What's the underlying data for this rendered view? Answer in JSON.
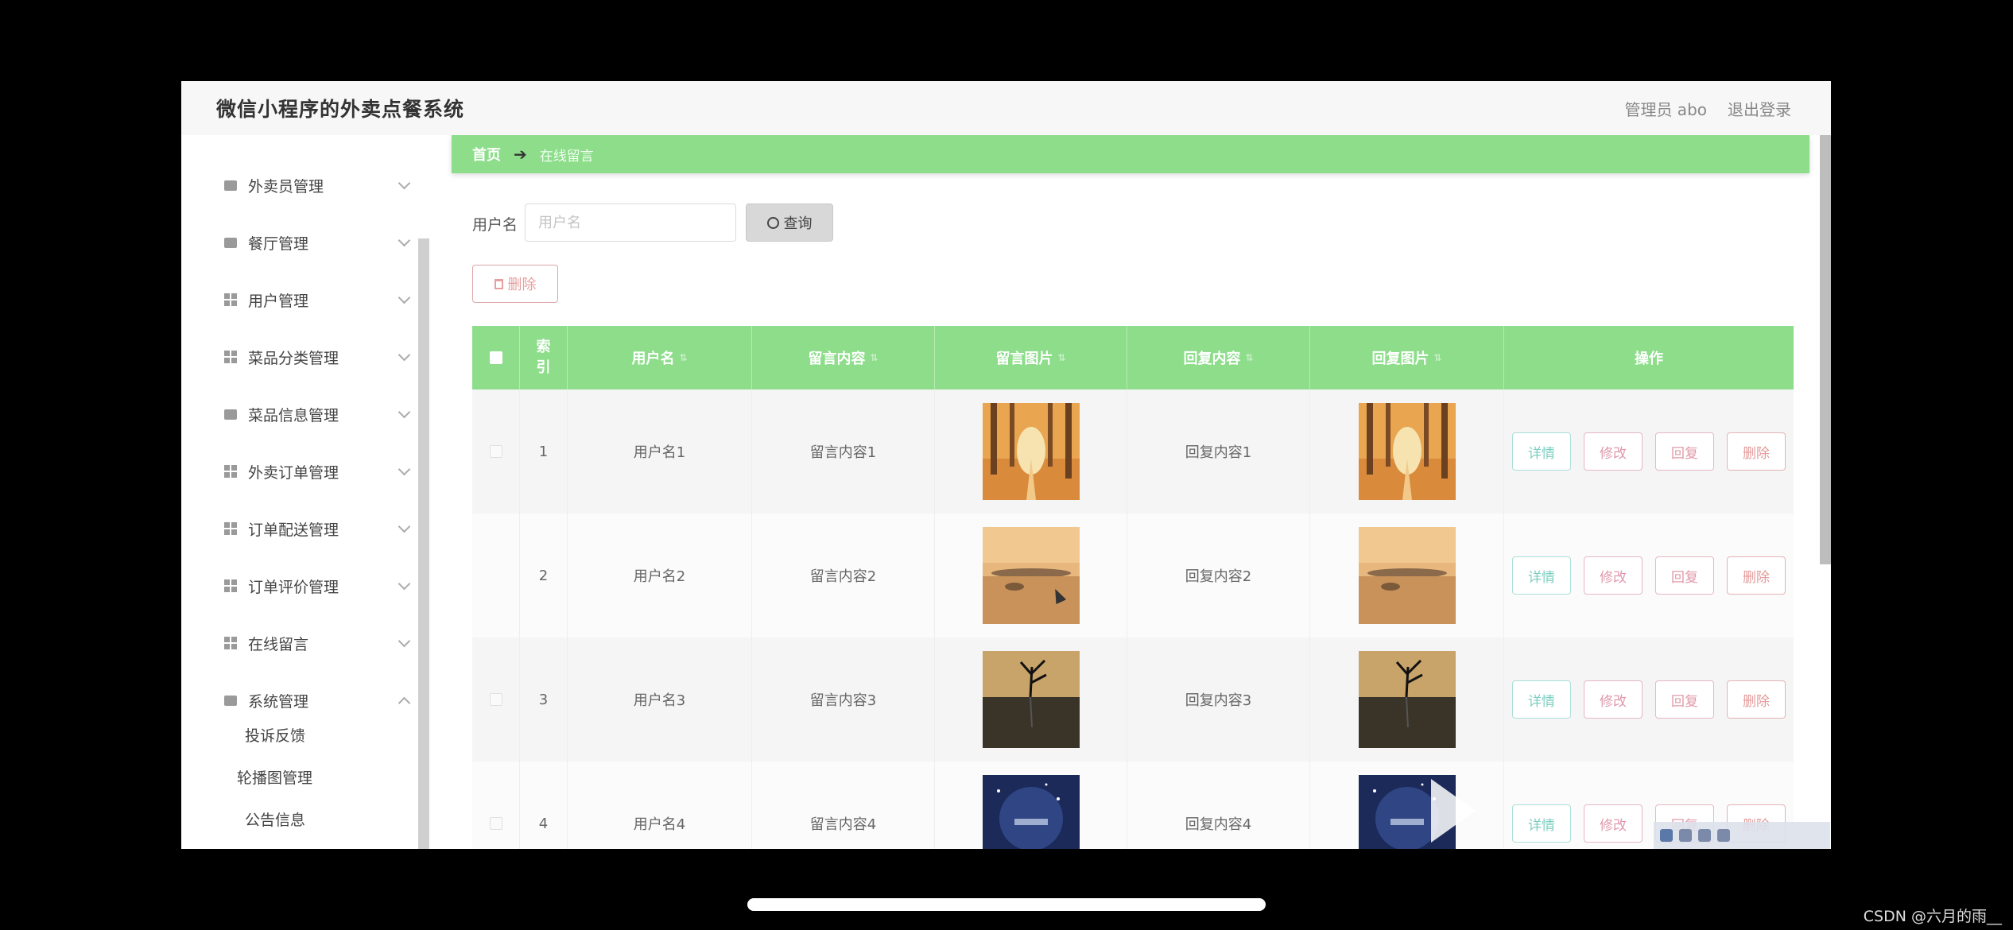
{
  "header": {
    "title": "微信小程序的外卖点餐系统",
    "user": "管理员 abo",
    "logout": "退出登录"
  },
  "sidebar": {
    "items": [
      {
        "label": "外卖员管理",
        "icon": "box"
      },
      {
        "label": "餐厅管理",
        "icon": "box"
      },
      {
        "label": "用户管理",
        "icon": "grid"
      },
      {
        "label": "菜品分类管理",
        "icon": "grid"
      },
      {
        "label": "菜品信息管理",
        "icon": "box"
      },
      {
        "label": "外卖订单管理",
        "icon": "grid"
      },
      {
        "label": "订单配送管理",
        "icon": "grid"
      },
      {
        "label": "订单评价管理",
        "icon": "grid"
      },
      {
        "label": "在线留言",
        "icon": "grid"
      },
      {
        "label": "系统管理",
        "icon": "box"
      }
    ],
    "sub_items": [
      "投诉反馈",
      "轮播图管理",
      "公告信息"
    ]
  },
  "breadcrumb": {
    "home": "首页",
    "current": "在线留言"
  },
  "search": {
    "label": "用户名",
    "placeholder": "用户名",
    "button": "查询"
  },
  "actions": {
    "delete": "删除"
  },
  "table": {
    "headers": [
      "索引",
      "用户名",
      "留言内容",
      "留言图片",
      "回复内容",
      "回复图片",
      "操作"
    ],
    "row_buttons": {
      "detail": "详情",
      "edit": "修改",
      "reply": "回复",
      "delete": "删除"
    },
    "rows": [
      {
        "index": "1",
        "username": "用户名1",
        "content": "留言内容1",
        "reply": "回复内容1",
        "image": "autumn-forest"
      },
      {
        "index": "2",
        "username": "用户名2",
        "content": "留言内容2",
        "reply": "回复内容2",
        "image": "misty-lake"
      },
      {
        "index": "3",
        "username": "用户名3",
        "content": "留言内容3",
        "reply": "回复内容3",
        "image": "lone-tree"
      },
      {
        "index": "4",
        "username": "用户名4",
        "content": "留言内容4",
        "reply": "回复内容4",
        "image": "night-sky"
      }
    ]
  },
  "footer": {
    "watermark": "CSDN @六月的雨__"
  }
}
